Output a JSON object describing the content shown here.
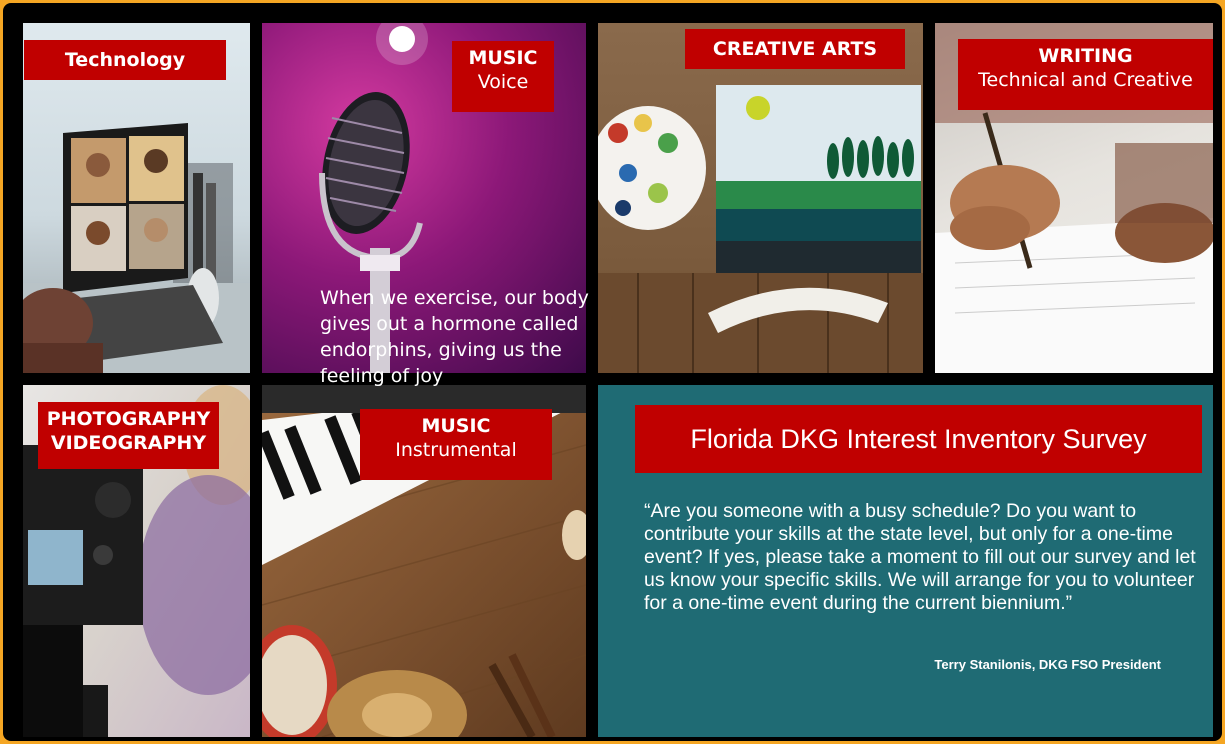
{
  "tiles": {
    "technology": {
      "title": "Technology"
    },
    "music_voice": {
      "title": "MUSIC",
      "subtitle": "Voice"
    },
    "creative_arts": {
      "title": "CREATIVE ARTS"
    },
    "writing": {
      "title": "WRITING",
      "subtitle": "Technical and Creative"
    },
    "photography": {
      "line1": "PHOTOGRAPHY",
      "line2": "VIDEOGRAPHY"
    },
    "music_instrumental": {
      "title": "MUSIC",
      "subtitle": "Instrumental"
    }
  },
  "overlay_text": "When we exercise, our body gives out a hormone called endorphins, giving us the feeling of joy",
  "survey": {
    "title": "Florida DKG Interest Inventory Survey",
    "quote": "“Are you someone with a busy schedule? Do you want to contribute your skills at the state level, but only for a one-time event? If yes, please take a moment to fill out our survey and let us know your specific skills. We will arrange for you to volunteer for a one-time event during the current biennium.”",
    "signature": "Terry Stanilonis, DKG FSO President"
  },
  "colors": {
    "frame": "#000000",
    "border": "#f5a623",
    "label_red": "#c00000",
    "survey_teal": "#1f6b74"
  }
}
